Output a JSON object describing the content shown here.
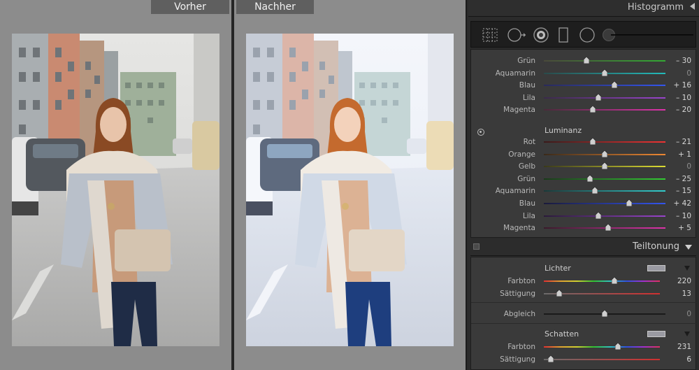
{
  "compare": {
    "before_label": "Vorher",
    "after_label": "Nachher"
  },
  "histogram": {
    "title": "Histogramm"
  },
  "tools": [
    "crop-overlay-icon",
    "spot-removal-icon",
    "red-eye-icon",
    "graduated-filter-icon",
    "radial-filter-icon",
    "adjustment-brush-icon"
  ],
  "hsl": {
    "top_rows": [
      {
        "label": "Grün",
        "value": "– 30",
        "pos": 0.35,
        "gradient": [
          "#4a4a3a",
          "#33aa33"
        ]
      },
      {
        "label": "Aquamarin",
        "value": "0",
        "pos": 0.5,
        "gradient": [
          "#2a4a4a",
          "#22bbbb"
        ]
      },
      {
        "label": "Blau",
        "value": "+ 16",
        "pos": 0.58,
        "gradient": [
          "#2a2a5a",
          "#3355ee"
        ]
      },
      {
        "label": "Lila",
        "value": "– 10",
        "pos": 0.45,
        "gradient": [
          "#3a2a4a",
          "#9944cc"
        ]
      },
      {
        "label": "Magenta",
        "value": "– 20",
        "pos": 0.4,
        "gradient": [
          "#4a2a3a",
          "#dd33aa"
        ]
      }
    ],
    "luminance_heading": "Luminanz",
    "luminance_rows": [
      {
        "label": "Rot",
        "value": "– 21",
        "pos": 0.4,
        "gradient": [
          "#3a1a1a",
          "#ee3333"
        ]
      },
      {
        "label": "Orange",
        "value": "+ 1",
        "pos": 0.5,
        "gradient": [
          "#3a2a1a",
          "#ee8833"
        ]
      },
      {
        "label": "Gelb",
        "value": "0",
        "pos": 0.5,
        "gradient": [
          "#3a3a1a",
          "#dddd33"
        ]
      },
      {
        "label": "Grün",
        "value": "– 25",
        "pos": 0.38,
        "gradient": [
          "#1a3a1a",
          "#33cc33"
        ]
      },
      {
        "label": "Aquamarin",
        "value": "– 15",
        "pos": 0.42,
        "gradient": [
          "#1a3a3a",
          "#33cccc"
        ]
      },
      {
        "label": "Blau",
        "value": "+ 42",
        "pos": 0.7,
        "gradient": [
          "#1a1a3a",
          "#3355ee"
        ]
      },
      {
        "label": "Lila",
        "value": "– 10",
        "pos": 0.45,
        "gradient": [
          "#2a1a3a",
          "#9944cc"
        ]
      },
      {
        "label": "Magenta",
        "value": "+ 5",
        "pos": 0.53,
        "gradient": [
          "#3a1a2a",
          "#dd33aa"
        ]
      }
    ]
  },
  "split_toning": {
    "title": "Teiltonung",
    "highlights_heading": "Lichter",
    "highlights_hue_label": "Farbton",
    "highlights_hue_value": "220",
    "highlights_hue_pos": 0.61,
    "highlights_sat_label": "Sättigung",
    "highlights_sat_value": "13",
    "highlights_sat_pos": 0.13,
    "balance_label": "Abgleich",
    "balance_value": "0",
    "balance_pos": 0.5,
    "shadows_heading": "Schatten",
    "shadows_hue_label": "Farbton",
    "shadows_hue_value": "231",
    "shadows_hue_pos": 0.64,
    "shadows_sat_label": "Sättigung",
    "shadows_sat_value": "6",
    "shadows_sat_pos": 0.06,
    "swatch_color": "#9a9aa2"
  }
}
